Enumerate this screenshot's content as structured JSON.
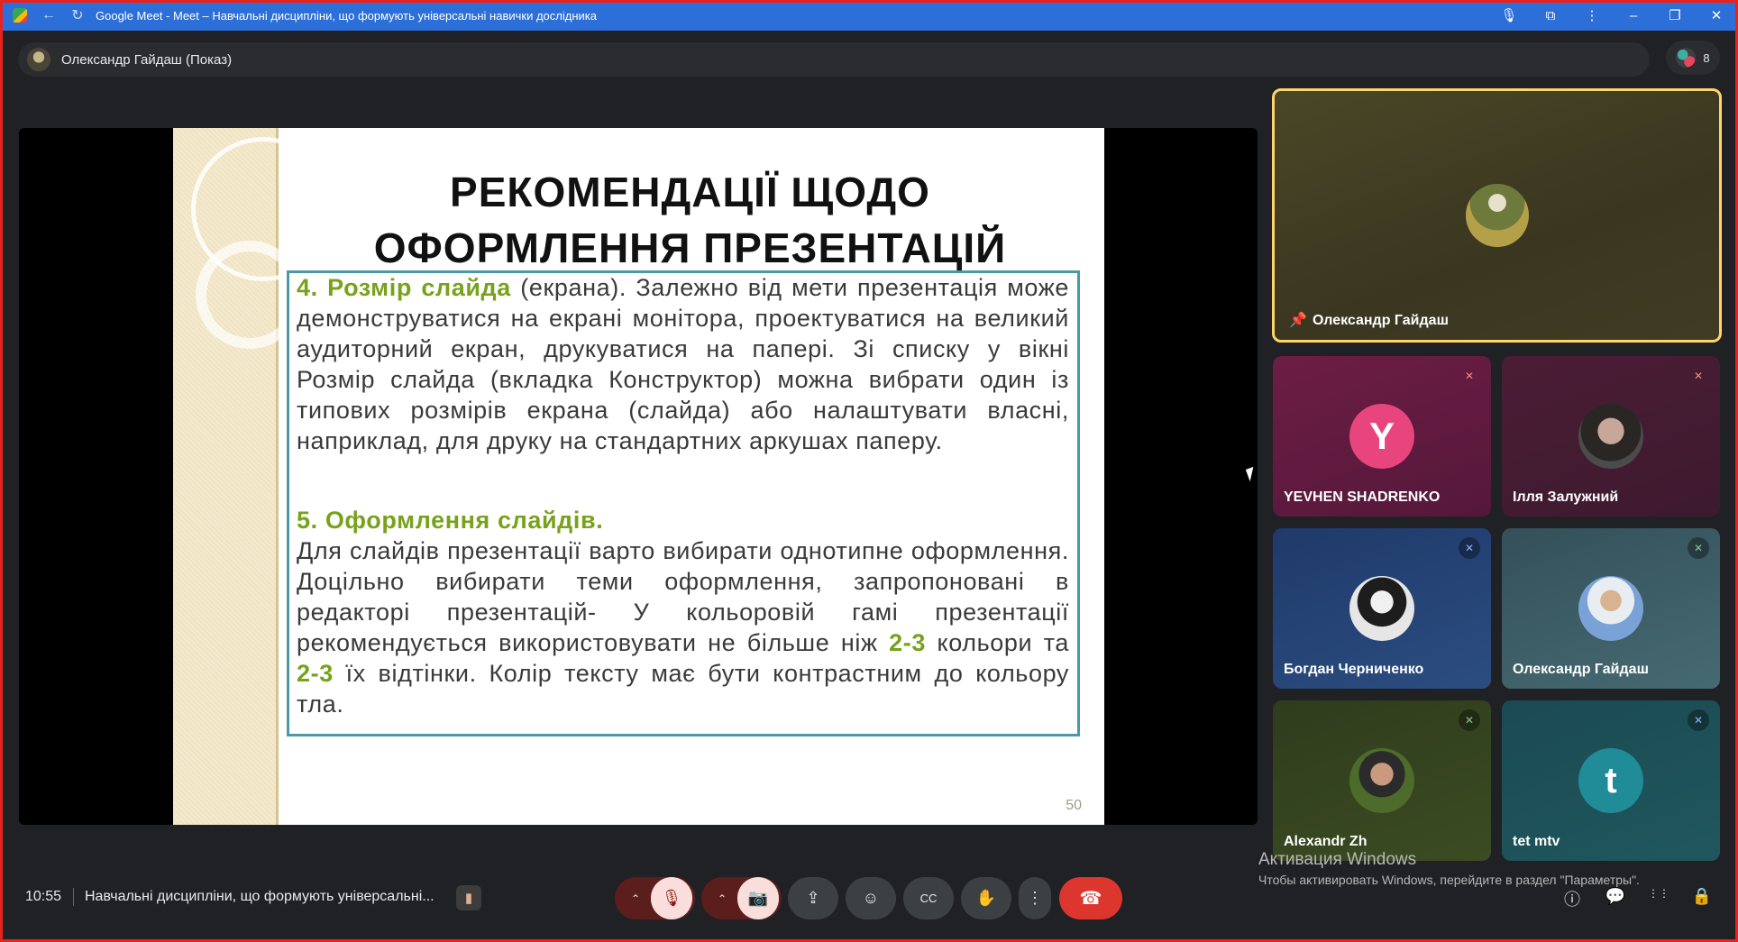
{
  "browser": {
    "tab_title": "Google Meet - Meet – Навчальні дисципліни, що формують універсальні навички дослідника",
    "nav_back": "←",
    "reload": "↻",
    "icons": [
      "mic-icon",
      "extensions-icon",
      "menu-icon",
      "minimize-icon",
      "restore-icon",
      "close-icon"
    ],
    "window_controls": [
      "🎙",
      "⧉",
      "⋮",
      "–",
      "❐",
      "✕"
    ]
  },
  "presenter_bar": {
    "name": "Олександр Гайдаш (Показ)"
  },
  "people_count": "8",
  "slide": {
    "title_line1": "РЕКОМЕНДАЦІЇ ЩОДО",
    "title_line2": "ОФОРМЛЕННЯ ПРЕЗЕНТАЦІЙ",
    "p1_bold": "4. Розмір слайда",
    "p1_text": " (екрана). Залежно від мети презентація може демонструватися на екрані монітора, проектуватися на великий аудиторний екран, друкуватися на папері. Зі списку у вікні Розмір слайда (вкладка Конструктор) можна вибрати один із типових розмірів екрана (слайда) або налаштувати власні, наприклад, для друку на стандартних аркушах паперу.",
    "p2_bold": "5. Оформлення слайдів.",
    "p2_text_a": "Для слайдів презентації варто вибирати однотипне оформлення. Доцільно вибирати теми оформлення, запропоновані в редакторі презентацій- У кольоровій гамі презентації рекомендується використовувати не більше ніж ",
    "p2_hl1": "2-3",
    "p2_text_b": " кольори та ",
    "p2_hl2": "2-3",
    "p2_text_c": " їх відтінки. Колір тексту має бути контрастним до кольору тла.",
    "page_number": "50"
  },
  "participants": {
    "pinned": "Олександр Гайдаш",
    "t1_initial": "Y",
    "t1_name": "YEVHEN SHADRENKO",
    "t2_name": "Ілля Залужний",
    "t3_name": "Богдан Черниченко",
    "t4_name": "Олександр Гайдаш",
    "t5_name": "Alexandr Zh",
    "t6_initial": "t",
    "t6_name": "tet mtv"
  },
  "activation": {
    "line1": "Активация Windows",
    "line2": "Чтобы активировать Windows, перейдите в раздел \"Параметры\"."
  },
  "bottom": {
    "time": "10:55",
    "meeting_title": "Навчальні дисципліни, що формують універсальні...",
    "icons": {
      "arrow": "⌃",
      "mic_off": "🎙",
      "cam_off": "📷",
      "present": "⇪",
      "emoji": "☺",
      "captions": "CC",
      "hand": "✋",
      "more": "⋮",
      "end": "☎",
      "info": "ⓘ",
      "chat": "💬",
      "activities": "⋮⋮",
      "host": "🔒"
    }
  },
  "colors": {
    "accent_green": "#78a21c",
    "end_call": "#dc362e",
    "pin_border": "#ffd56b"
  }
}
